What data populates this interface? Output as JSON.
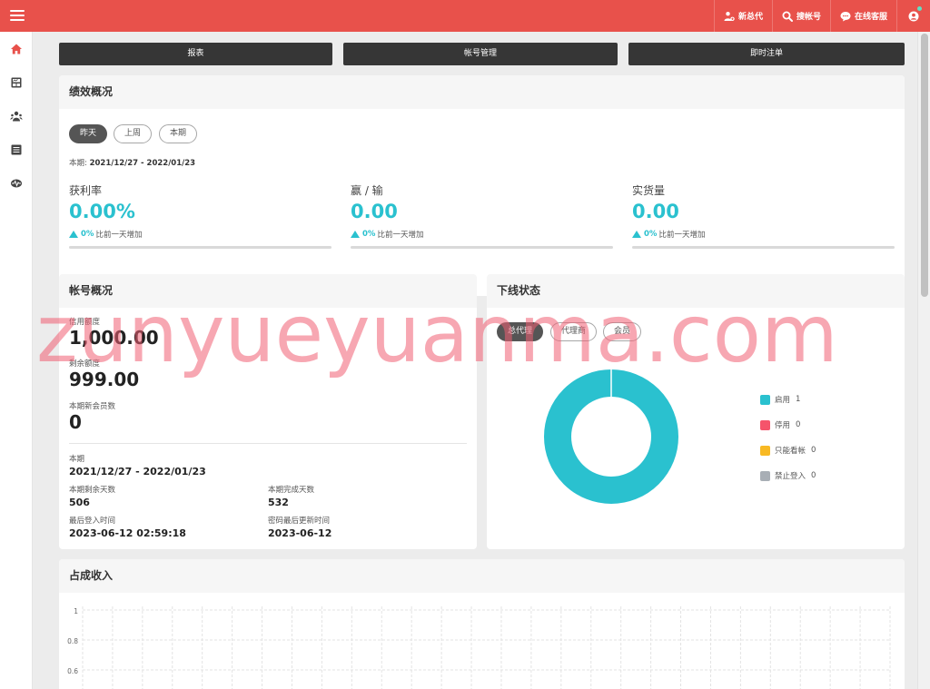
{
  "header": {
    "items": [
      {
        "label": "新总代",
        "icon": "users-add-icon"
      },
      {
        "label": "搜帐号",
        "icon": "search-icon"
      },
      {
        "label": "在线客服",
        "icon": "chat-icon"
      }
    ],
    "user_icon": "user-circle-icon",
    "online_color": "#5fe0c3"
  },
  "sidebar": {
    "icons": [
      "home-icon",
      "report-icon",
      "accounts-icon",
      "list-icon",
      "activity-icon"
    ],
    "active_color": "#e8514b"
  },
  "nav": {
    "report": "报表",
    "account_mgmt": "帐号管理",
    "instant_bets": "即时注单"
  },
  "performance": {
    "title": "绩效概况",
    "tabs": [
      "昨天",
      "上周",
      "本期"
    ],
    "active_tab": "昨天",
    "period_label": "本期:",
    "period_value": "2021/12/27 - 2022/01/23",
    "metrics": [
      {
        "label": "获利率",
        "value": "0.00%",
        "pct": "0%",
        "text": "比前一天增加"
      },
      {
        "label": "赢 / 输",
        "value": "0.00",
        "pct": "0%",
        "text": "比前一天增加"
      },
      {
        "label": "实货量",
        "value": "0.00",
        "pct": "0%",
        "text": "比前一天增加"
      }
    ]
  },
  "account": {
    "title": "帐号概况",
    "credit_label": "信用额度",
    "credit_value": "1,000.00",
    "balance_label": "剩余额度",
    "balance_value": "999.00",
    "new_members_label": "本期新会员数",
    "new_members_value": "0",
    "period_label": "本期",
    "period_value": "2021/12/27 - 2022/01/23",
    "remaining_days_label": "本期剩余天数",
    "remaining_days_value": "506",
    "completed_days_label": "本期完成天数",
    "completed_days_value": "532",
    "last_login_label": "最后登入时间",
    "last_login_value": "2023-06-12 02:59:18",
    "pwd_update_label": "密码最后更新时间",
    "pwd_update_value": "2023-06-12"
  },
  "downline": {
    "title": "下线状态",
    "tabs": [
      "总代理",
      "代理商",
      "会员"
    ],
    "active_tab": "总代理",
    "legend": [
      {
        "label": "启用",
        "count": "1",
        "color": "#2ac1cf"
      },
      {
        "label": "停用",
        "count": "0",
        "color": "#f5546b"
      },
      {
        "label": "只能看帐",
        "count": "0",
        "color": "#f8b924"
      },
      {
        "label": "禁止登入",
        "count": "0",
        "color": "#a8aeb5"
      }
    ]
  },
  "income": {
    "title": "占成收入",
    "y_ticks": [
      "1",
      "0.8",
      "0.6"
    ]
  },
  "chart_data": {
    "type": "pie",
    "categories": [
      "启用",
      "停用",
      "只能看帐",
      "禁止登入"
    ],
    "values": [
      1,
      0,
      0,
      0
    ],
    "colors": [
      "#2ac1cf",
      "#f5546b",
      "#f8b924",
      "#a8aeb5"
    ]
  },
  "watermark": "zunyueyuanma.com"
}
